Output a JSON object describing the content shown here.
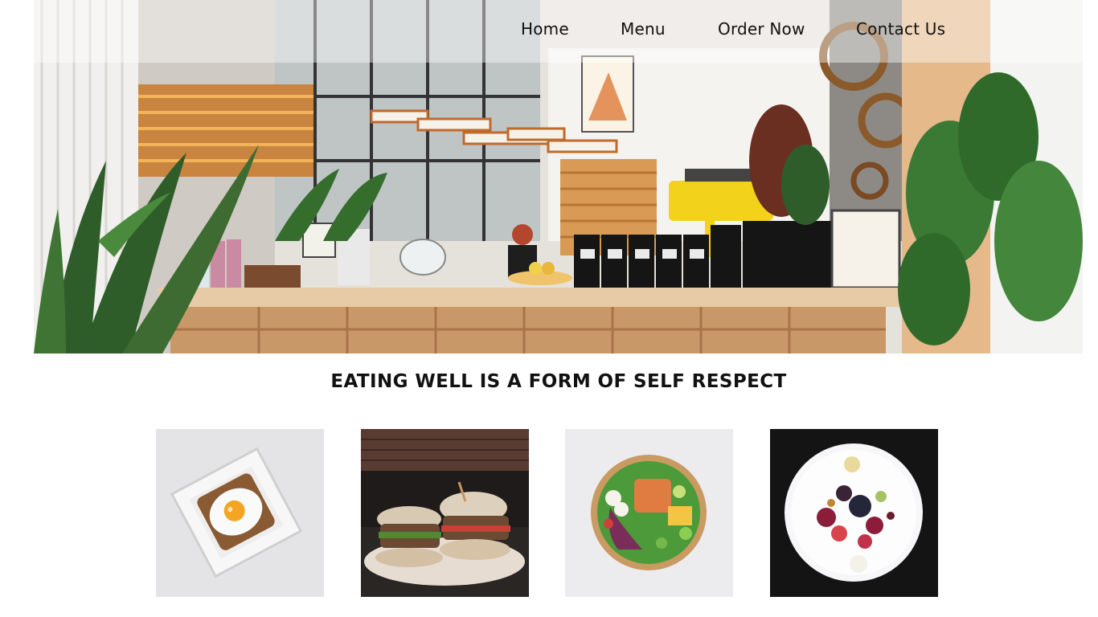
{
  "nav": {
    "items": [
      {
        "label": "Home"
      },
      {
        "label": "Menu"
      },
      {
        "label": "Order Now"
      },
      {
        "label": "Contact Us"
      }
    ]
  },
  "hero": {
    "image": "cafe-interior-photo"
  },
  "headline": {
    "text": "EATING WELL IS A FORM OF SELF RESPECT"
  },
  "gallery": {
    "items": [
      {
        "image": "egg-toast-photo"
      },
      {
        "image": "burgers-photo"
      },
      {
        "image": "salad-bowl-photo"
      },
      {
        "image": "fruit-plate-photo"
      }
    ]
  },
  "colors": {
    "nav_overlay": "#ffffffaa",
    "text": "#111111",
    "background": "#ffffff",
    "counter_wood": "#d9b48a",
    "espresso_machine": "#f2d21a",
    "plant_green": "#2f5d2a"
  }
}
